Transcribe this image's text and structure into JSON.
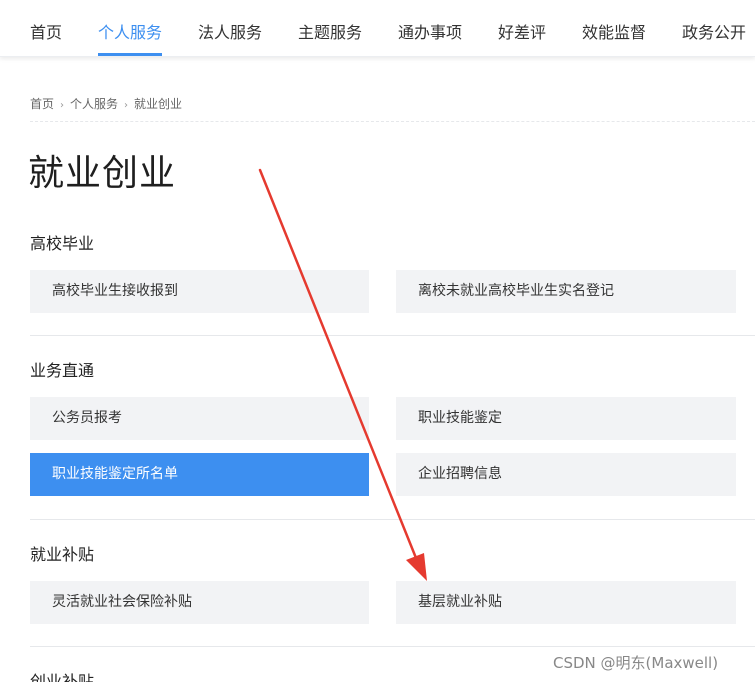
{
  "nav": {
    "items": [
      {
        "label": "首页",
        "active": false
      },
      {
        "label": "个人服务",
        "active": true
      },
      {
        "label": "法人服务",
        "active": false
      },
      {
        "label": "主题服务",
        "active": false
      },
      {
        "label": "通办事项",
        "active": false
      },
      {
        "label": "好差评",
        "active": false
      },
      {
        "label": "效能监督",
        "active": false
      },
      {
        "label": "政务公开",
        "active": false
      }
    ]
  },
  "breadcrumb": [
    "首页",
    "个人服务",
    "就业创业"
  ],
  "page_title": "就业创业",
  "sections": [
    {
      "title": "高校毕业",
      "items": [
        "高校毕业生接收报到",
        "离校未就业高校毕业生实名登记"
      ]
    },
    {
      "title": "业务直通",
      "items": [
        "公务员报考",
        "职业技能鉴定",
        "职业技能鉴定所名单",
        "企业招聘信息"
      ],
      "active_item": "职业技能鉴定所名单"
    },
    {
      "title": "就业补贴",
      "items": [
        "灵活就业社会保险补贴",
        "基层就业补贴"
      ]
    },
    {
      "title": "创业补贴",
      "items": []
    }
  ],
  "watermark": "CSDN @明东(Maxwell)",
  "colors": {
    "accent": "#3d8ff0",
    "card_bg": "#f2f3f5",
    "arrow": "#e53a2f"
  }
}
